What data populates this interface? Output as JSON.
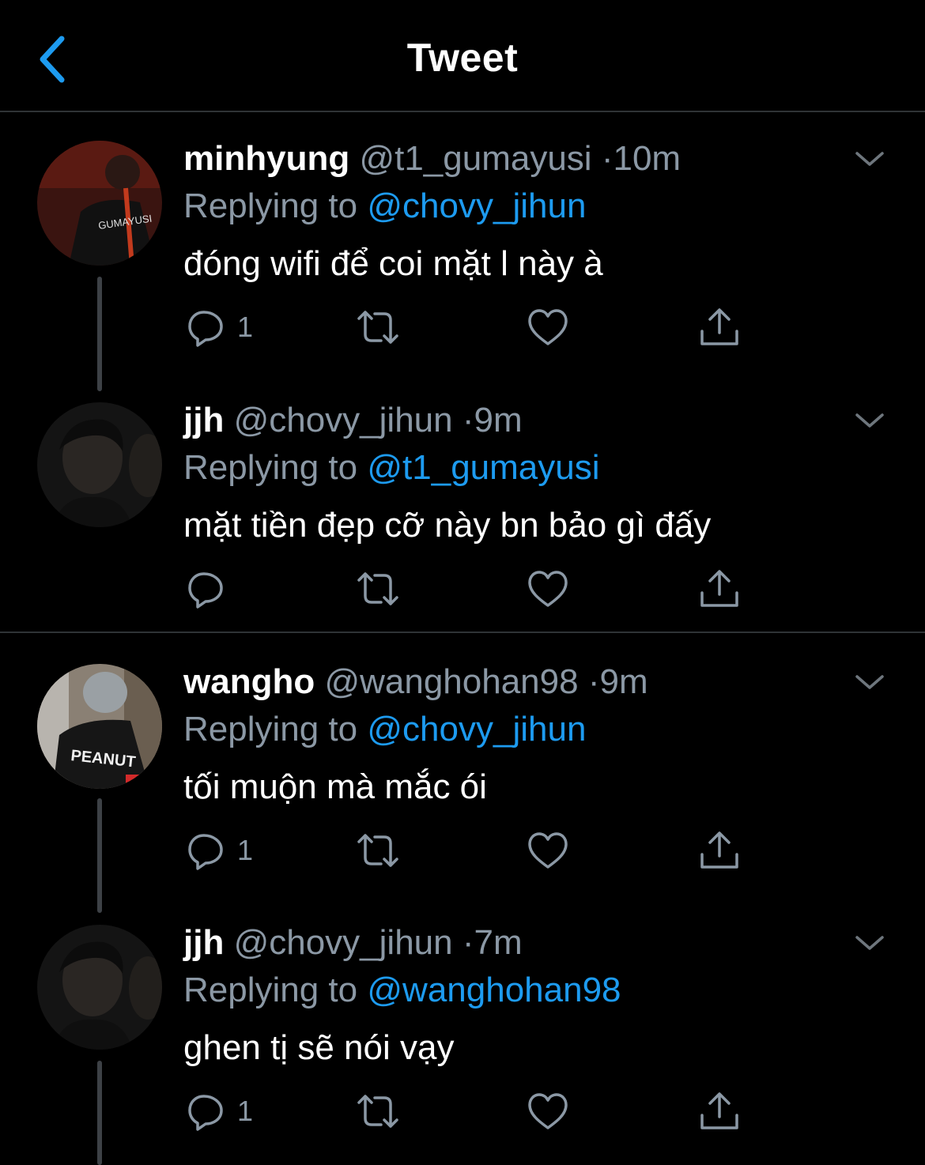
{
  "header": {
    "title": "Tweet",
    "back_icon": "chevron-left-icon",
    "accent": "#1d9bf0"
  },
  "tweets": [
    {
      "name": "minhyung",
      "handle": "@t1_gumayusi",
      "time": "10m",
      "replying_prefix": "Replying to",
      "replying_to": "@chovy_jihun",
      "text": "đóng wifi để coi mặt l này à",
      "reply_count": "1",
      "avatar_text": "GUMAYUSI"
    },
    {
      "name": "jjh",
      "handle": "@chovy_jihun",
      "time": "9m",
      "replying_prefix": "Replying to",
      "replying_to": "@t1_gumayusi",
      "text": "mặt tiền đẹp cỡ này bn bảo gì đấy",
      "reply_count": "",
      "avatar_text": ""
    },
    {
      "name": "wangho",
      "handle": "@wanghohan98",
      "time": "9m",
      "replying_prefix": "Replying to",
      "replying_to": "@chovy_jihun",
      "text": "tối muộn mà mắc ói",
      "reply_count": "1",
      "avatar_text": "PEANUT"
    },
    {
      "name": "jjh",
      "handle": "@chovy_jihun",
      "time": "7m",
      "replying_prefix": "Replying to",
      "replying_to": "@wanghohan98",
      "text": "ghen tị sẽ nói vạy",
      "reply_count": "1",
      "avatar_text": ""
    }
  ],
  "separator": "·",
  "icons": [
    "reply-icon",
    "retweet-icon",
    "like-icon",
    "share-icon",
    "chevron-down-icon"
  ]
}
